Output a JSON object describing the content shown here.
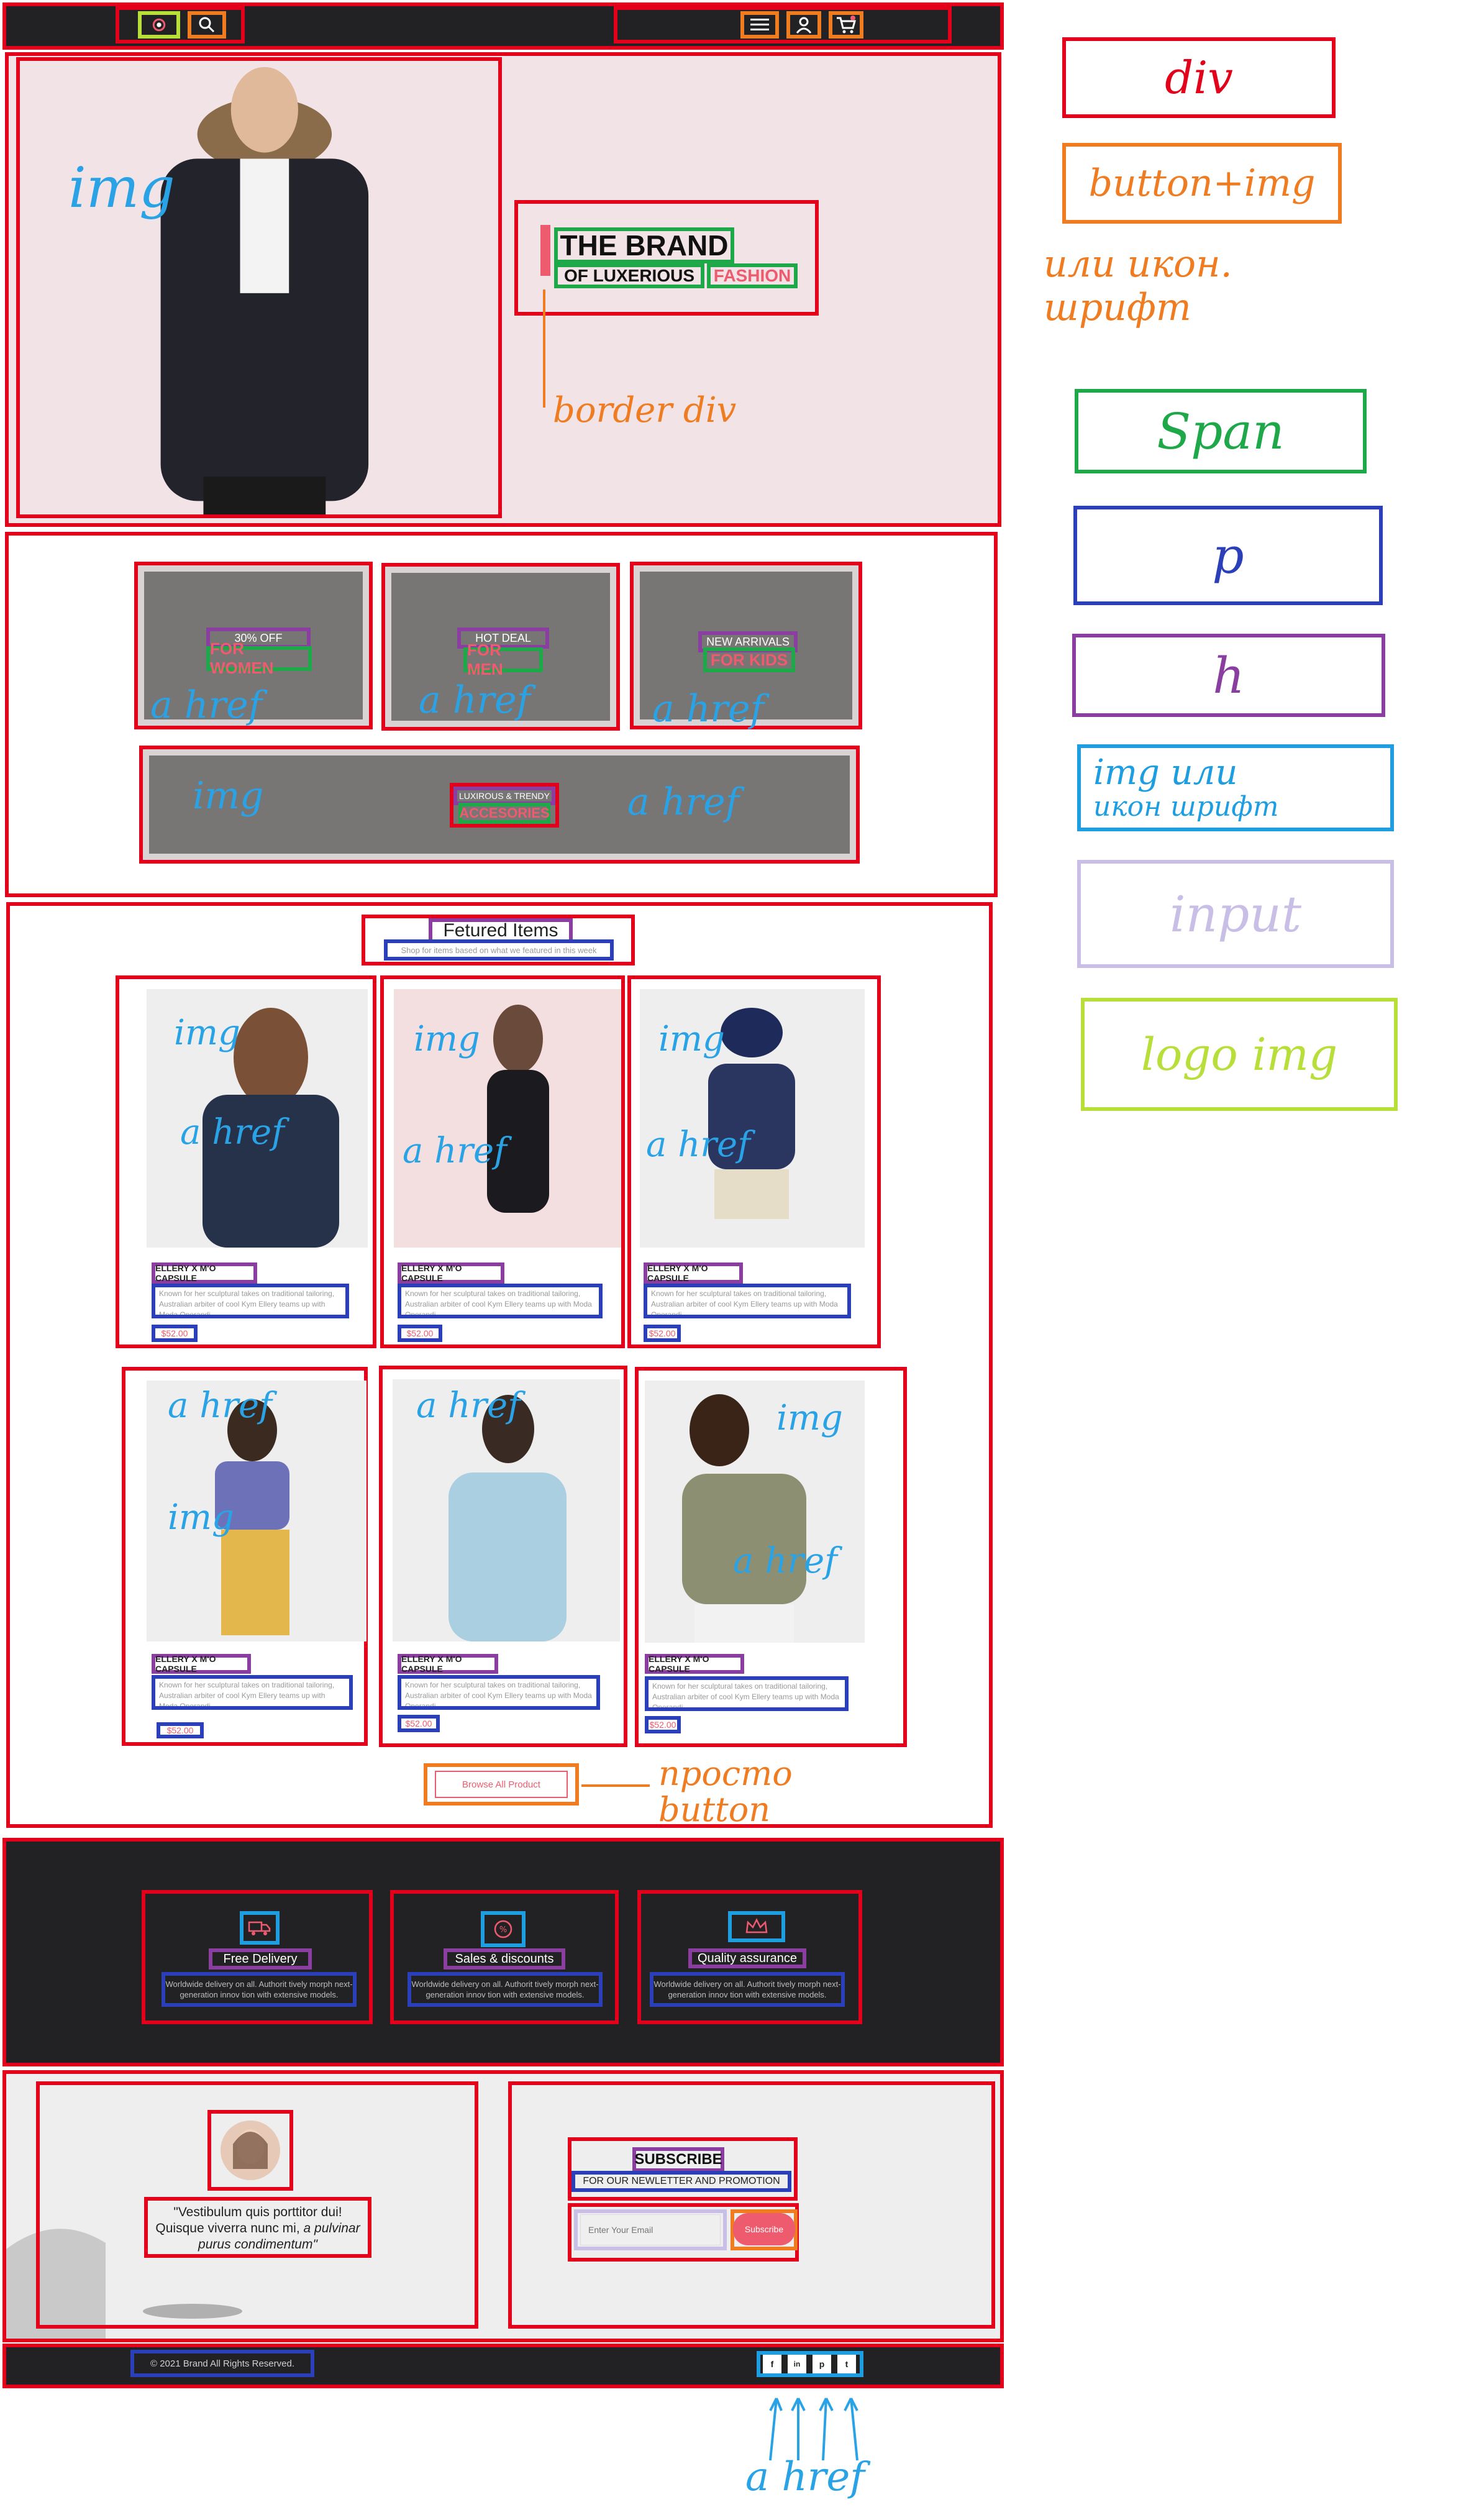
{
  "header": {
    "brand_logo_icon": "eye-logo",
    "search_icon": "search-icon",
    "menu_icon": "hamburger-icon",
    "account_icon": "user-icon",
    "cart_icon": "cart-icon"
  },
  "hero": {
    "title": "THE BRAND",
    "subtitle_part1": "OF LUXERIOUS",
    "subtitle_part2": "FASHION"
  },
  "categories": [
    {
      "top": "30% OFF",
      "title": "FOR WOMEN"
    },
    {
      "top": "HOT DEAL",
      "title": "FOR MEN"
    },
    {
      "top": "NEW ARRIVALS",
      "title": "FOR KIDS"
    },
    {
      "top": "LUXIROUS & TRENDY",
      "title": "ACCESORIES"
    }
  ],
  "featured": {
    "heading": "Fetured Items",
    "subheading": "Shop for items based on what we featured in this week",
    "cta": "Browse All Product",
    "products": [
      {
        "title": "ELLERY X M'O CAPSULE",
        "desc": "Known for her sculptural takes on traditional tailoring, Australian arbiter of cool Kym Ellery teams up with Moda Operandi.",
        "price": "$52.00"
      },
      {
        "title": "ELLERY X M'O CAPSULE",
        "desc": "Known for her sculptural takes on traditional tailoring, Australian arbiter of cool Kym Ellery teams up with Moda Operandi.",
        "price": "$52.00"
      },
      {
        "title": "ELLERY X M'O CAPSULE",
        "desc": "Known for her sculptural takes on traditional tailoring, Australian arbiter of cool Kym Ellery teams up with Moda Operandi.",
        "price": "$52.00"
      },
      {
        "title": "ELLERY X M'O CAPSULE",
        "desc": "Known for her sculptural takes on traditional tailoring, Australian arbiter of cool Kym Ellery teams up with Moda Operandi.",
        "price": "$52.00"
      },
      {
        "title": "ELLERY X M'O CAPSULE",
        "desc": "Known for her sculptural takes on traditional tailoring, Australian arbiter of cool Kym Ellery teams up with Moda Operandi.",
        "price": "$52.00"
      },
      {
        "title": "ELLERY X M'O CAPSULE",
        "desc": "Known for her sculptural takes on traditional tailoring, Australian arbiter of cool Kym Ellery teams up with Moda Operandi.",
        "price": "$52.00"
      }
    ]
  },
  "features": [
    {
      "icon": "truck-icon",
      "title": "Free Delivery",
      "desc": "Worldwide delivery on all. Authorit tively morph next-generation innov tion with extensive models."
    },
    {
      "icon": "percent-icon",
      "title": "Sales & discounts",
      "desc": "Worldwide delivery on all. Authorit tively morph next-generation innov tion with extensive models."
    },
    {
      "icon": "crown-icon",
      "title": "Quality assurance",
      "desc": "Worldwide delivery on all. Authorit tively morph next-generation innov tion with extensive models."
    }
  ],
  "testimonial": {
    "quote_line1": "\"Vestibulum quis porttitor dui! Quisque",
    "quote_line2": "viverra nunc mi,",
    "quote_italic": "a pulvinar purus condimentum\""
  },
  "subscribe": {
    "title": "SUBSCRIBE",
    "subtitle": "FOR OUR NEWLETTER AND PROMOTION",
    "placeholder": "Enter Your Email",
    "button": "Subscribe"
  },
  "footer": {
    "copyright": "© 2021  Brand  All Rights Reserved.",
    "social": [
      "f",
      "in",
      "p",
      "t"
    ]
  },
  "legend": {
    "div": "div",
    "button": "button+img",
    "button_note": "или икон. шрифт",
    "span": "Span",
    "p": "p",
    "h": "h",
    "img": "img или",
    "img_note": "икон шрифт",
    "input": "input",
    "logo": "logo img"
  },
  "annotations": {
    "img": "img",
    "a_href": "a href",
    "border_div": "border div",
    "simple_button": "просто button"
  },
  "colors": {
    "accent_pink": "#ef5b6e",
    "dark": "#222224",
    "hero_bg": "#f1e3e6",
    "red": "#e3001b",
    "orange": "#f07c22",
    "green": "#1fa84a",
    "blue": "#2b3fb8",
    "purple": "#8a3ea0",
    "cyan": "#1e9ee0",
    "lilac": "#c9bfe6",
    "lime": "#b8de3a"
  }
}
